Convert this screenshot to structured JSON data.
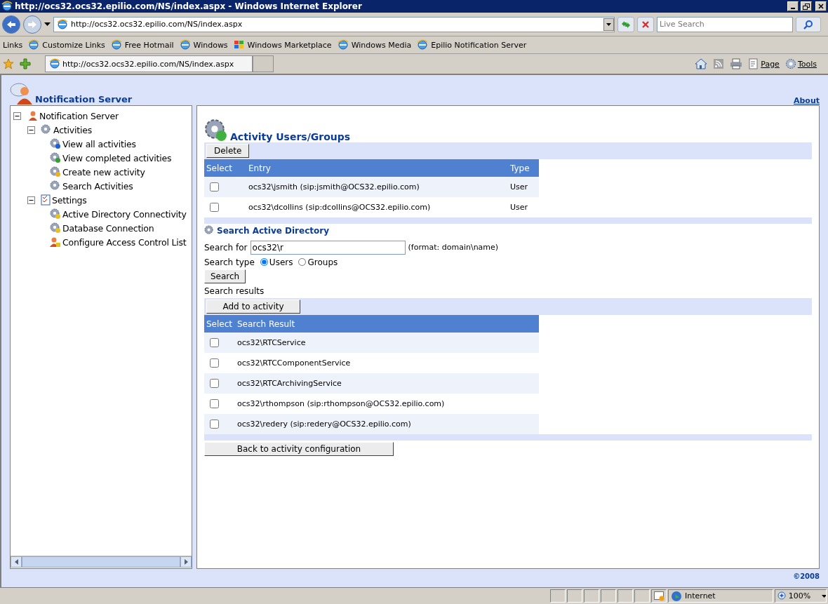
{
  "window": {
    "title": "http://ocs32.ocs32.epilio.com/NS/index.aspx - Windows Internet Explorer"
  },
  "address_bar": {
    "value": "http://ocs32.ocs32.epilio.com/NS/index.aspx"
  },
  "search": {
    "placeholder": "Live Search"
  },
  "links_bar": {
    "label": "Links",
    "items": [
      "Customize Links",
      "Free Hotmail",
      "Windows",
      "Windows Marketplace",
      "Windows Media",
      "Epilio Notification Server"
    ]
  },
  "tab": {
    "title": "http://ocs32.ocs32.epilio.com/NS/index.aspx"
  },
  "command_bar": {
    "page": "Page",
    "tools": "Tools"
  },
  "app": {
    "title": "Notification Server",
    "about": "About",
    "footer": "©2008"
  },
  "tree": [
    {
      "label": "Notification Server",
      "expanded": true,
      "children": [
        {
          "label": "Activities",
          "expanded": true,
          "children": [
            {
              "label": "View all activities"
            },
            {
              "label": "View completed activities"
            },
            {
              "label": "Create new activity"
            },
            {
              "label": "Search Activities"
            }
          ]
        },
        {
          "label": "Settings",
          "expanded": true,
          "children": [
            {
              "label": "Active Directory Connectivity"
            },
            {
              "label": "Database Connection"
            },
            {
              "label": "Configure Access Control List"
            }
          ]
        }
      ]
    }
  ],
  "users_section": {
    "title": "Activity Users/Groups",
    "delete_button": "Delete",
    "columns": [
      "Select",
      "Entry",
      "Type"
    ],
    "rows": [
      {
        "checked": false,
        "entry": "ocs32\\jsmith (sip:jsmith@OCS32.epilio.com)",
        "type": "User"
      },
      {
        "checked": false,
        "entry": "ocs32\\dcollins (sip:dcollins@OCS32.epilio.com)",
        "type": "User"
      }
    ]
  },
  "search_section": {
    "title": "Search Active Directory",
    "search_for_label": "Search for",
    "search_for_value": "ocs32\\r",
    "format_hint": "(format: domain\\name)",
    "search_type_label": "Search type",
    "options": [
      {
        "label": "Users",
        "selected": true
      },
      {
        "label": "Groups",
        "selected": false
      }
    ],
    "search_button": "Search",
    "results_label": "Search results",
    "add_button": "Add to activity",
    "columns": [
      "Select",
      "Search Result"
    ],
    "rows": [
      {
        "checked": false,
        "result": "ocs32\\RTCService"
      },
      {
        "checked": false,
        "result": "ocs32\\RTCComponentService"
      },
      {
        "checked": false,
        "result": "ocs32\\RTCArchivingService"
      },
      {
        "checked": false,
        "result": "ocs32\\rthompson (sip:rthompson@OCS32.epilio.com)"
      },
      {
        "checked": false,
        "result": "ocs32\\redery (sip:redery@OCS32.epilio.com)"
      }
    ],
    "back_button": "Back to activity configuration"
  },
  "status_bar": {
    "zone": "Internet",
    "zoom": "100%"
  }
}
